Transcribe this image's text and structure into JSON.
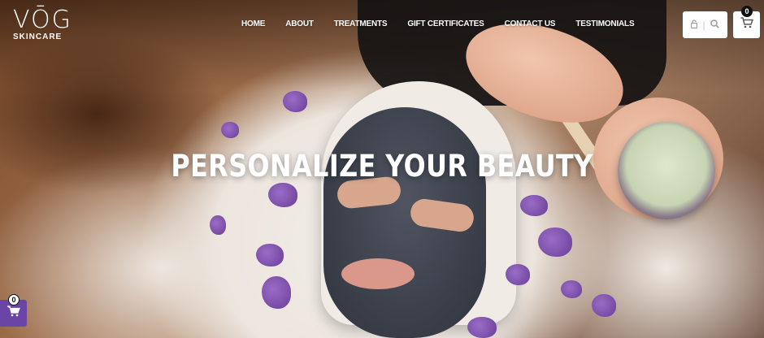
{
  "brand": {
    "logo_mark": "VŌG",
    "logo_sub": "SKINCARE"
  },
  "nav": {
    "items": [
      {
        "label": "HOME",
        "name": "nav-home"
      },
      {
        "label": "ABOUT",
        "name": "nav-about"
      },
      {
        "label": "TREATMENTS",
        "name": "nav-treatments"
      },
      {
        "label": "GIFT CERTIFICATES",
        "name": "nav-gift-certificates"
      },
      {
        "label": "CONTACT US",
        "name": "nav-contact-us"
      },
      {
        "label": "TESTIMONIALS",
        "name": "nav-testimonials"
      }
    ]
  },
  "header": {
    "account_icon": "lock-icon",
    "search_icon": "search-icon",
    "cart_icon": "cart-icon",
    "cart_count": "0"
  },
  "hero": {
    "headline": "PERSONALIZE YOUR BEAUTY"
  },
  "floating_cart": {
    "icon": "cart-icon",
    "count": "0"
  },
  "colors": {
    "accent_purple": "#6b45a5",
    "text_white": "#ffffff"
  }
}
